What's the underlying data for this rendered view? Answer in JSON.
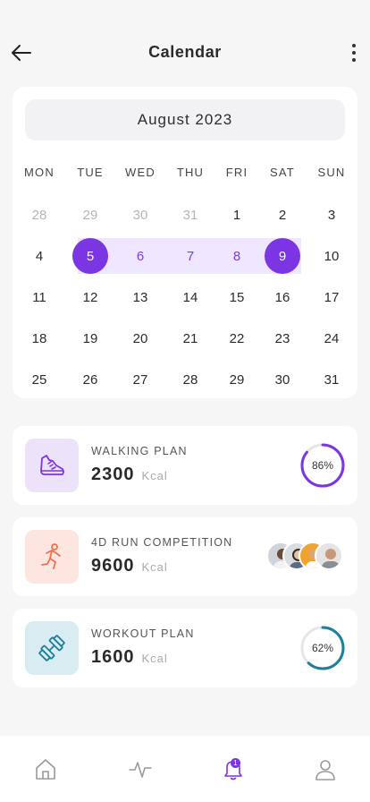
{
  "header": {
    "title": "Calendar"
  },
  "calendar": {
    "month": "August 2023",
    "weekdays": [
      "MON",
      "TUE",
      "WED",
      "THU",
      "FRI",
      "SAT",
      "SUN"
    ],
    "weeks": [
      [
        "28",
        "29",
        "30",
        "31",
        "1",
        "2",
        "3"
      ],
      [
        "4",
        "5",
        "6",
        "7",
        "8",
        "9",
        "10"
      ],
      [
        "11",
        "12",
        "13",
        "14",
        "15",
        "16",
        "17"
      ],
      [
        "18",
        "19",
        "20",
        "21",
        "22",
        "23",
        "24"
      ],
      [
        "25",
        "26",
        "27",
        "28",
        "29",
        "30",
        "31"
      ]
    ],
    "range_start": "5",
    "range_end": "9"
  },
  "plans": [
    {
      "label": "WALKING PLAN",
      "value": "2300",
      "unit": "Kcal",
      "progress_text": "86%",
      "progress": 0.86,
      "accent": "#7b35e3",
      "icon": "sneaker-icon",
      "icon_bg": "#ece3fb"
    },
    {
      "label": "4D RUN COMPETITION",
      "value": "9600",
      "unit": "Kcal",
      "accent": "#f0714f",
      "icon": "runner-icon",
      "icon_bg": "#fde6df"
    },
    {
      "label": "WORKOUT PLAN",
      "value": "1600",
      "unit": "Kcal",
      "progress_text": "62%",
      "progress": 0.62,
      "accent": "#1e7f9a",
      "icon": "dumbbell-icon",
      "icon_bg": "#d9ecf1"
    }
  ],
  "nav": {
    "items": [
      "home-icon",
      "activity-icon",
      "bell-icon",
      "profile-icon"
    ],
    "notification_count": "1"
  },
  "colors": {
    "accent": "#7b35e3",
    "range_band": "#efe6ff",
    "background": "#f6f6f7"
  }
}
